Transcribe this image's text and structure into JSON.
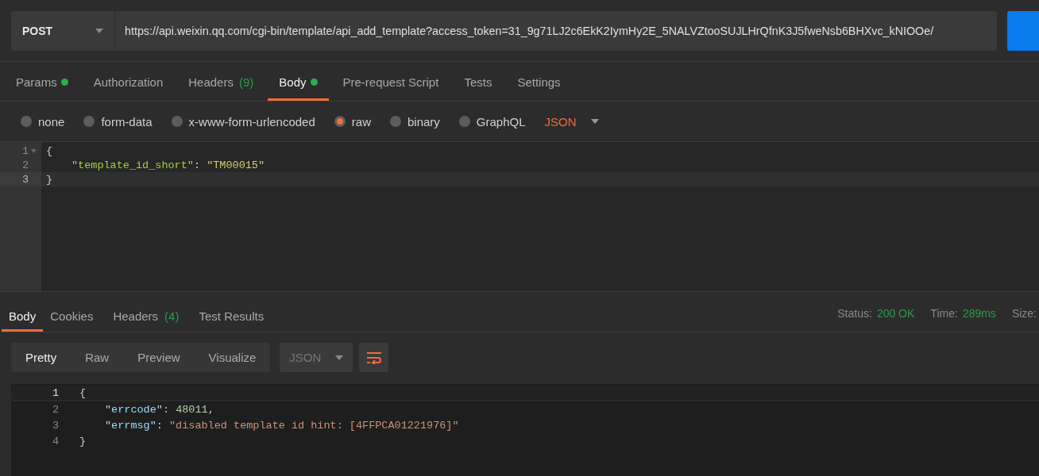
{
  "request": {
    "method": "POST",
    "url": "https://api.weixin.qq.com/cgi-bin/template/api_add_template?access_token=31_9g71LJ2c6EkK2IymHy2E_5NALVZtooSUJLHrQfnK3J5fweNsb6BHXvc_kNIOOe/"
  },
  "request_tabs": [
    {
      "label": "Params",
      "dot": true,
      "selected": false
    },
    {
      "label": "Authorization",
      "dot": false,
      "selected": false
    },
    {
      "label": "Headers",
      "count": "(9)",
      "dot": false,
      "selected": false
    },
    {
      "label": "Body",
      "dot": true,
      "selected": true
    },
    {
      "label": "Pre-request Script",
      "dot": false,
      "selected": false
    },
    {
      "label": "Tests",
      "dot": false,
      "selected": false
    },
    {
      "label": "Settings",
      "dot": false,
      "selected": false
    }
  ],
  "body_types": [
    {
      "label": "none",
      "selected": false
    },
    {
      "label": "form-data",
      "selected": false
    },
    {
      "label": "x-www-form-urlencoded",
      "selected": false
    },
    {
      "label": "raw",
      "selected": true
    },
    {
      "label": "binary",
      "selected": false
    },
    {
      "label": "GraphQL",
      "selected": false
    }
  ],
  "raw_format": "JSON",
  "request_body": [
    {
      "number": "1",
      "foldable": true,
      "indented": false,
      "current": false,
      "tokens": [
        {
          "kind": "punct",
          "text": "{"
        }
      ]
    },
    {
      "number": "2",
      "foldable": false,
      "indented": true,
      "current": false,
      "tokens": [
        {
          "kind": "key",
          "text": "\"template_id_short\""
        },
        {
          "kind": "punct",
          "text": ": "
        },
        {
          "kind": "string",
          "text": "\"TM00015\""
        }
      ]
    },
    {
      "number": "3",
      "foldable": false,
      "indented": false,
      "current": true,
      "tokens": [
        {
          "kind": "punct",
          "text": "}"
        }
      ]
    }
  ],
  "response_tabs": [
    {
      "label": "Body",
      "selected": true
    },
    {
      "label": "Cookies",
      "selected": false
    },
    {
      "label": "Headers",
      "count": "(4)",
      "selected": false
    },
    {
      "label": "Test Results",
      "selected": false
    }
  ],
  "status": [
    {
      "label": "Status:",
      "value": "200 OK"
    },
    {
      "label": "Time:",
      "value": "289ms"
    },
    {
      "label": "Size:"
    }
  ],
  "view_modes": [
    {
      "label": "Pretty",
      "selected": true
    },
    {
      "label": "Raw",
      "selected": false
    },
    {
      "label": "Preview",
      "selected": false
    },
    {
      "label": "Visualize",
      "selected": false
    }
  ],
  "response_format": "JSON",
  "response_body": [
    {
      "number": "1",
      "indented": false,
      "current": true,
      "tokens": [
        {
          "kind": "punct",
          "text": "{"
        }
      ]
    },
    {
      "number": "2",
      "indented": true,
      "current": false,
      "tokens": [
        {
          "kind": "rkey",
          "text": "\"errcode\""
        },
        {
          "kind": "punct",
          "text": ": "
        },
        {
          "kind": "number",
          "text": "48011"
        },
        {
          "kind": "punct",
          "text": ","
        }
      ]
    },
    {
      "number": "3",
      "indented": true,
      "current": false,
      "tokens": [
        {
          "kind": "rkey",
          "text": "\"errmsg\""
        },
        {
          "kind": "punct",
          "text": ": "
        },
        {
          "kind": "rstring",
          "text": "\"disabled template id hint: [4FFPCA01221976]\""
        }
      ]
    },
    {
      "number": "4",
      "indented": false,
      "current": false,
      "tokens": [
        {
          "kind": "punct",
          "text": "}"
        }
      ]
    }
  ]
}
